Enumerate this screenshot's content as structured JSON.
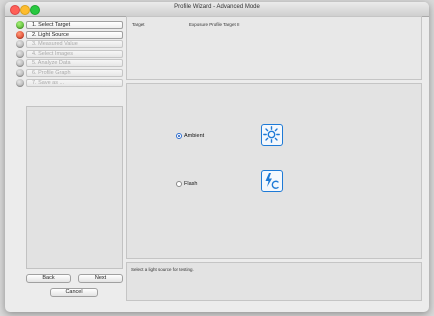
{
  "window": {
    "title": "Profile Wizard - Advanced Mode"
  },
  "steps": [
    {
      "label": "1. Select Target",
      "status": "green",
      "enabled": true
    },
    {
      "label": "2. Light Source",
      "status": "red",
      "enabled": true
    },
    {
      "label": "3. Measured Value",
      "status": "gray",
      "enabled": false
    },
    {
      "label": "4. Select Images",
      "status": "gray",
      "enabled": false
    },
    {
      "label": "5. Analyze Data",
      "status": "gray",
      "enabled": false
    },
    {
      "label": "6. Profile Graph",
      "status": "gray",
      "enabled": false
    },
    {
      "label": "7. Save as ...",
      "status": "gray",
      "enabled": false
    }
  ],
  "top_pane": {
    "target_header": "Target",
    "target_value": "Exposure Profile Target II"
  },
  "light_source": {
    "options": [
      {
        "label": "Ambient",
        "selected": true,
        "icon": "ambient-light-icon"
      },
      {
        "label": "Flash",
        "selected": false,
        "icon": "flash-light-icon"
      }
    ]
  },
  "status": {
    "message": "Select a light source for testing."
  },
  "buttons": {
    "back": "Back",
    "next": "Next",
    "cancel": "Cancel"
  },
  "colors": {
    "accent": "#1e7ad6"
  }
}
